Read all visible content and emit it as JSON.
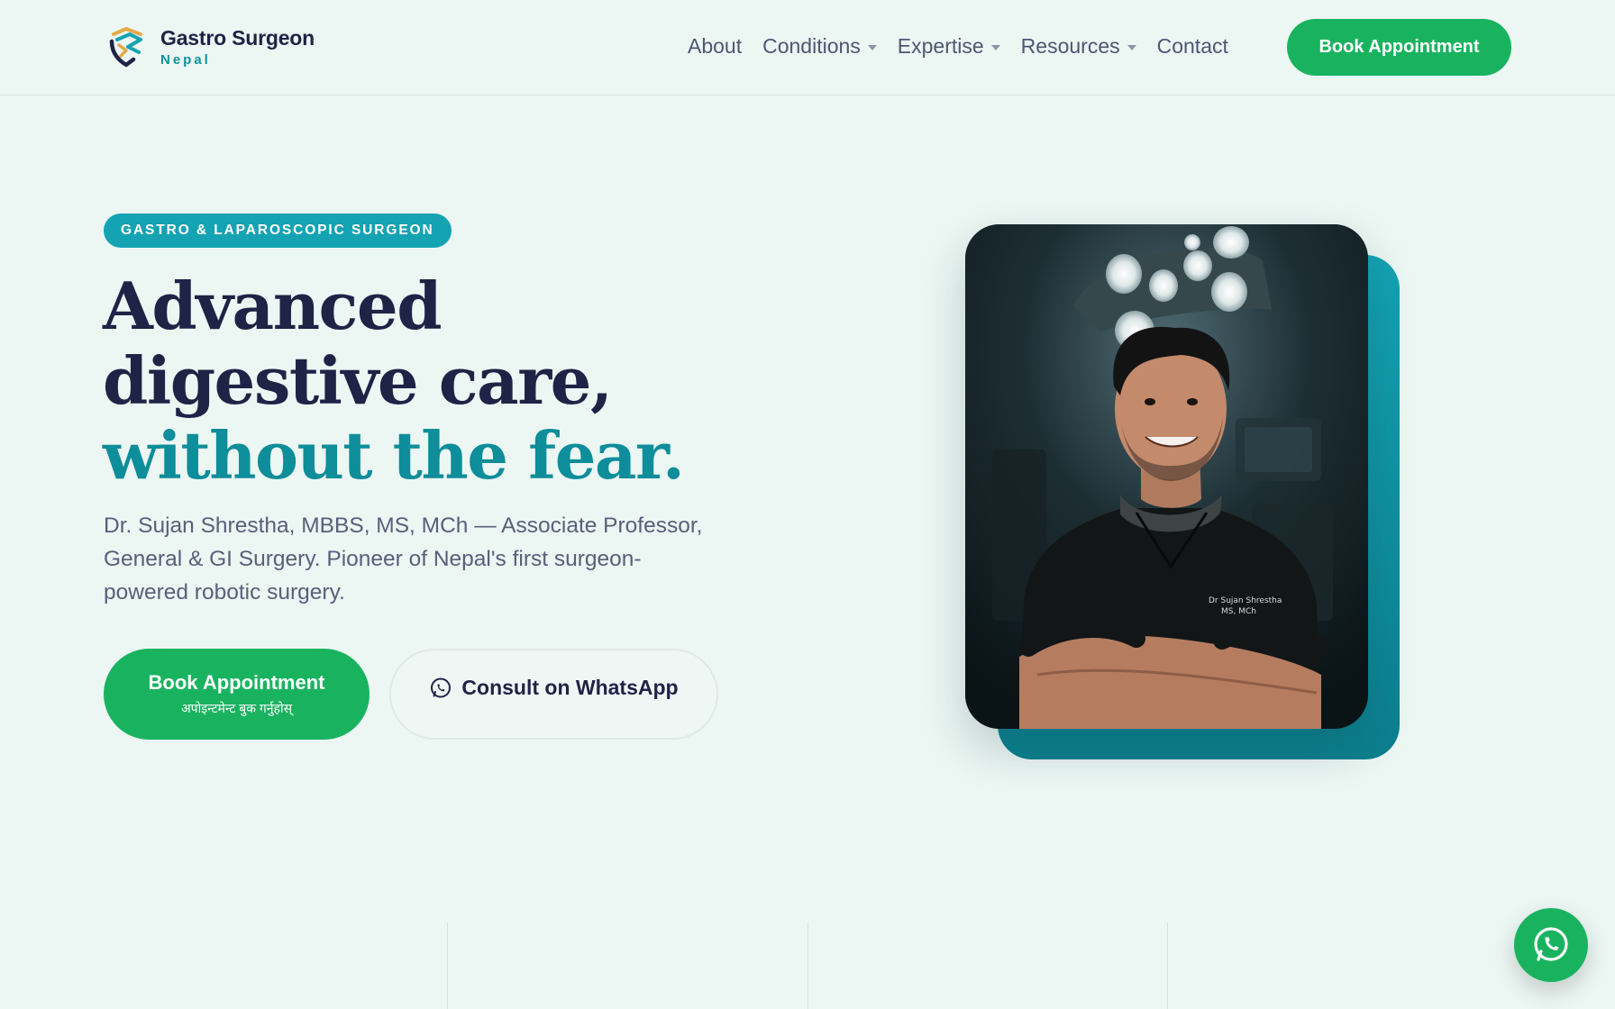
{
  "brand": {
    "name": "Gastro Surgeon",
    "sub": "Nepal",
    "logo_icon": "gs-shield-logo-icon"
  },
  "nav": {
    "items": [
      {
        "label": "About",
        "has_dropdown": false
      },
      {
        "label": "Conditions",
        "has_dropdown": true
      },
      {
        "label": "Expertise",
        "has_dropdown": true
      },
      {
        "label": "Resources",
        "has_dropdown": true
      },
      {
        "label": "Contact",
        "has_dropdown": false
      }
    ],
    "cta_label": "Book Appointment"
  },
  "hero": {
    "badge": "GASTRO & LAPAROSCOPIC SURGEON",
    "headline_line1": "Advanced",
    "headline_line2": "digestive care,",
    "headline_accent": "without the fear.",
    "lede": "Dr. Sujan Shrestha, MBBS, MS, MCh — Associate Professor, General & GI Surgery. Pioneer of Nepal's first surgeon-powered robotic surgery.",
    "primary_cta": "Book Appointment",
    "primary_cta_sub": "अपोइन्टमेन्ट बुक गर्नुहोस्",
    "secondary_cta": "Consult on WhatsApp",
    "secondary_icon": "whatsapp-icon"
  },
  "photo": {
    "scrub_name": "Dr Sujan Shrestha",
    "scrub_title": "MS, MCh"
  },
  "fab": {
    "icon": "whatsapp-icon"
  },
  "colors": {
    "background": "#ecf6f3",
    "primary_green": "#19b35f",
    "teal": "#0e8d9a",
    "badge_teal": "#14a3b3",
    "navy": "#1f2346",
    "muted": "#58607a"
  }
}
